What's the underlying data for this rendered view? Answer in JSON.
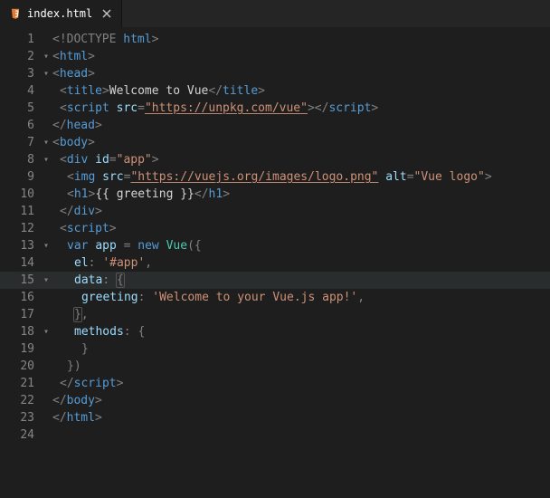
{
  "tab": {
    "filename": "index.html",
    "icon": "html-file-icon",
    "close": "×"
  },
  "folds": {
    "collapsed": "▸",
    "expanded": "▾"
  },
  "lines": [
    {
      "n": 1,
      "fold": "",
      "indent": 0
    },
    {
      "n": 2,
      "fold": "expanded",
      "indent": 0
    },
    {
      "n": 3,
      "fold": "expanded",
      "indent": 0
    },
    {
      "n": 4,
      "fold": "",
      "indent": 1
    },
    {
      "n": 5,
      "fold": "",
      "indent": 1
    },
    {
      "n": 6,
      "fold": "",
      "indent": 0
    },
    {
      "n": 7,
      "fold": "expanded",
      "indent": 0
    },
    {
      "n": 8,
      "fold": "expanded",
      "indent": 1
    },
    {
      "n": 9,
      "fold": "",
      "indent": 2
    },
    {
      "n": 10,
      "fold": "",
      "indent": 2
    },
    {
      "n": 11,
      "fold": "",
      "indent": 1
    },
    {
      "n": 12,
      "fold": "",
      "indent": 1
    },
    {
      "n": 13,
      "fold": "expanded",
      "indent": 2
    },
    {
      "n": 14,
      "fold": "",
      "indent": 3
    },
    {
      "n": 15,
      "fold": "expanded",
      "indent": 3,
      "current": true
    },
    {
      "n": 16,
      "fold": "",
      "indent": 4
    },
    {
      "n": 17,
      "fold": "",
      "indent": 3
    },
    {
      "n": 18,
      "fold": "expanded",
      "indent": 3
    },
    {
      "n": 19,
      "fold": "",
      "indent": 4
    },
    {
      "n": 20,
      "fold": "",
      "indent": 2
    },
    {
      "n": 21,
      "fold": "",
      "indent": 1
    },
    {
      "n": 22,
      "fold": "",
      "indent": 0
    },
    {
      "n": 23,
      "fold": "",
      "indent": 0
    },
    {
      "n": 24,
      "fold": "",
      "indent": 0
    }
  ],
  "tokens": {
    "doctype_open": "<!",
    "doctype_word": "DOCTYPE",
    "html_word": "html",
    "gt": ">",
    "lt": "<",
    "slash": "/",
    "eq": "=",
    "html_tag": "html",
    "head_tag": "head",
    "title_tag": "title",
    "script_tag": "script",
    "body_tag": "body",
    "div_tag": "div",
    "img_tag": "img",
    "h1_tag": "h1",
    "attr_src": "src",
    "attr_id": "id",
    "attr_alt": "alt",
    "val_vue_cdn": "\"https://unpkg.com/vue\"",
    "val_app": "\"app\"",
    "val_logo": "\"https://vuejs.org/images/logo.png\"",
    "val_alt": "\"Vue logo\"",
    "title_text": "Welcome to Vue",
    "mustache": "{{ greeting }}",
    "kw_var": "var",
    "ident_app": "app",
    "kw_new": "new",
    "ident_Vue": "Vue",
    "open_paren": "(",
    "close_paren": ")",
    "open_brace": "{",
    "close_brace": "}",
    "comma": ",",
    "prop_el": "el",
    "colon": ":",
    "val_el": "'#app'",
    "prop_data": "data",
    "prop_greeting": "greeting",
    "val_greeting": "'Welcome to your Vue.js app!'",
    "prop_methods": "methods",
    "close_brace_paren": "})",
    "space": " "
  }
}
